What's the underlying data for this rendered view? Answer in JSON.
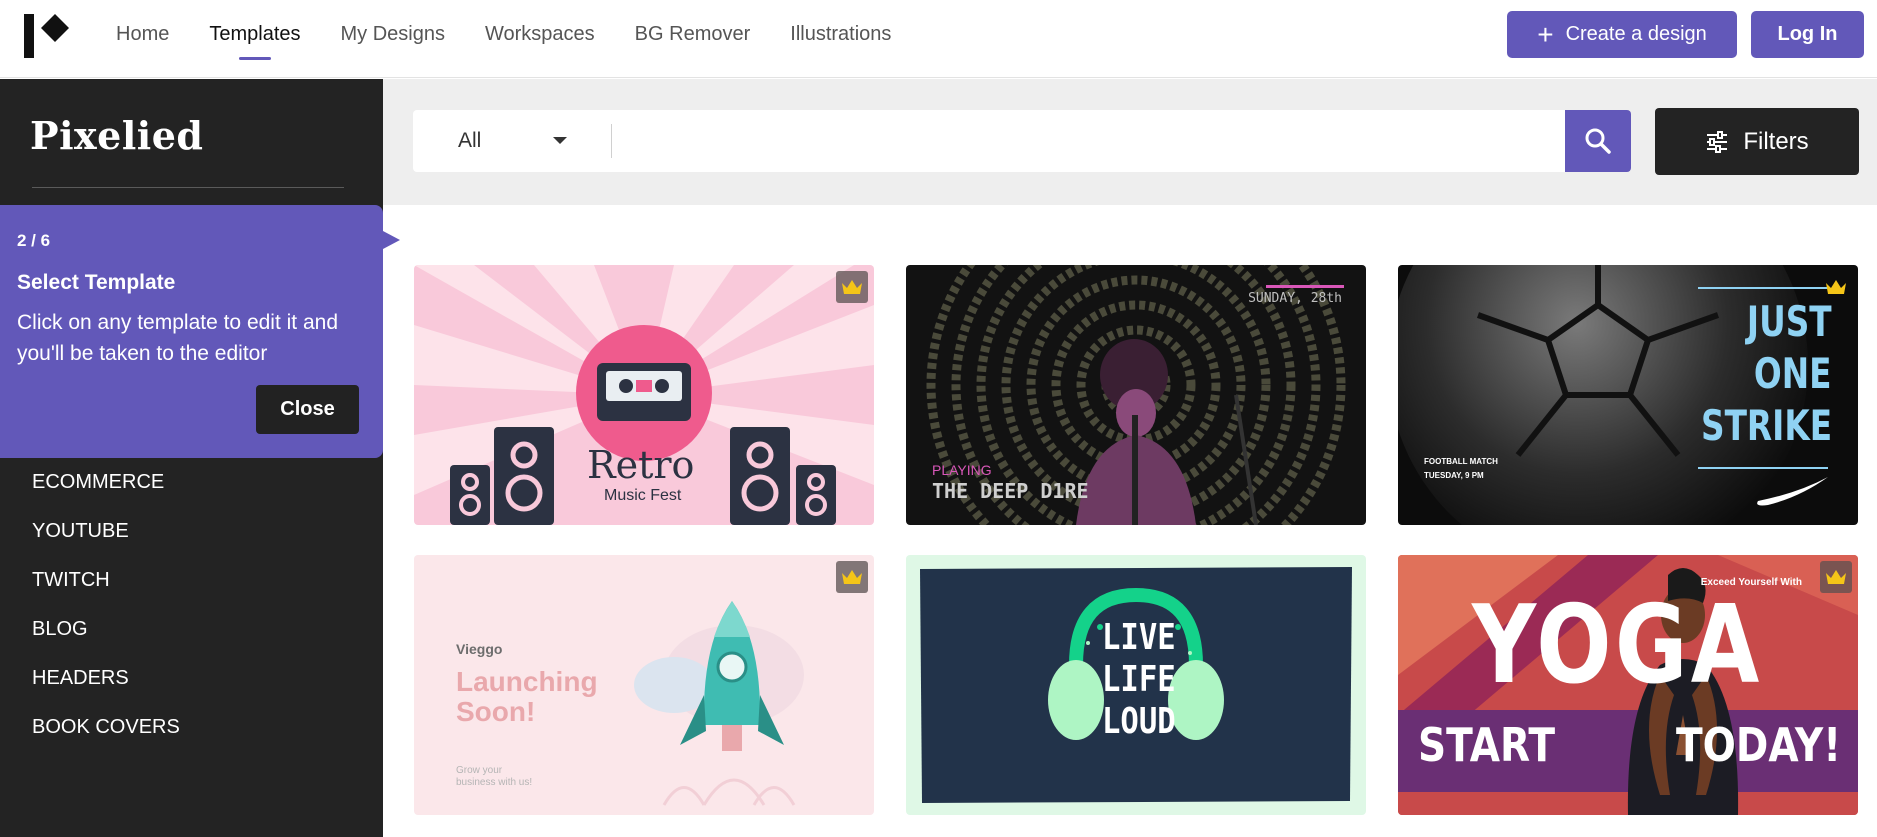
{
  "colors": {
    "accent": "#6258b9",
    "dark": "#232323",
    "search_band": "#eeeeee"
  },
  "nav": {
    "logo_icon": "pixelied-logo-icon",
    "items": [
      {
        "label": "Home",
        "active": false
      },
      {
        "label": "Templates",
        "active": true
      },
      {
        "label": "My Designs",
        "active": false
      },
      {
        "label": "Workspaces",
        "active": false
      },
      {
        "label": "BG Remover",
        "active": false
      },
      {
        "label": "Illustrations",
        "active": false
      }
    ],
    "create_label": "Create a design",
    "login_label": "Log In"
  },
  "sidebar": {
    "brand": "Pixelied",
    "categories": [
      "ECOMMERCE",
      "YOUTUBE",
      "TWITCH",
      "BLOG",
      "HEADERS",
      "BOOK COVERS"
    ]
  },
  "tour": {
    "step": "2 / 6",
    "title": "Select Template",
    "body": "Click on any template to edit it and you'll be taken to the editor",
    "close_label": "Close"
  },
  "search": {
    "category": "All",
    "value": "",
    "placeholder": "",
    "filters_label": "Filters"
  },
  "templates": [
    {
      "premium": true,
      "title": "Retro",
      "subtitle": "Music Fest"
    },
    {
      "premium": false,
      "date": "SUNDAY, 28th",
      "playing": "PLAYING",
      "title": "THE DEEP D1RE"
    },
    {
      "premium": true,
      "lines": [
        "JUST",
        "ONE",
        "STRIKE"
      ],
      "small1": "FOOTBALL MATCH",
      "small2": "TUESDAY, 9 PM"
    },
    {
      "premium": true,
      "brand": "Vieggo",
      "title_l1": "Launching",
      "title_l2": "Soon!",
      "sub_l1": "Grow your",
      "sub_l2": "business with us!"
    },
    {
      "premium": false,
      "lines": [
        "LIVE",
        "LIFE",
        "LOUD"
      ]
    },
    {
      "premium": true,
      "tagline": "Exceed Yourself With",
      "title": "YOGA",
      "start": "START",
      "today": "TODAY!"
    }
  ]
}
